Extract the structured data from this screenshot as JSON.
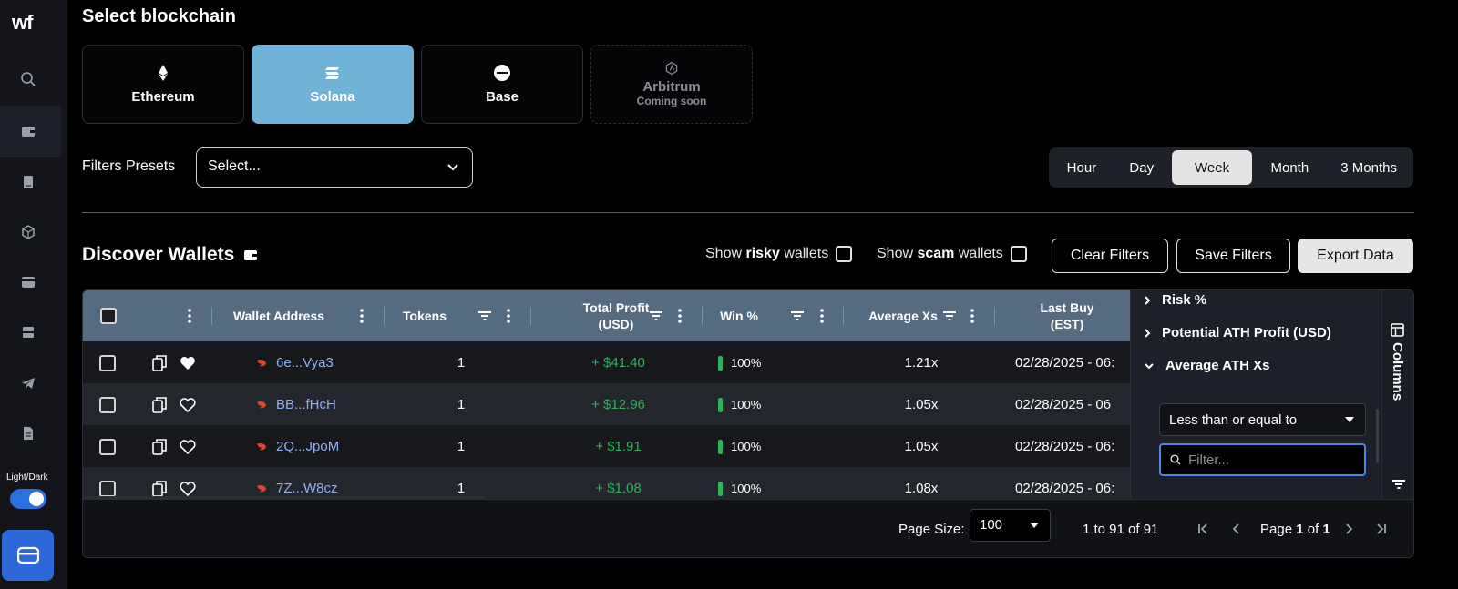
{
  "sidebar": {
    "logo": "wf",
    "toggle_label": "Light/Dark"
  },
  "blockchain": {
    "title": "Select blockchain",
    "options": [
      {
        "label": "Ethereum",
        "icon": "ethereum-icon"
      },
      {
        "label": "Solana",
        "icon": "solana-icon",
        "active": true
      },
      {
        "label": "Base",
        "icon": "base-icon"
      },
      {
        "label": "Arbitrum",
        "icon": "arbitrum-icon",
        "sub": "Coming soon",
        "disabled": true
      }
    ]
  },
  "filters": {
    "presets_label": "Filters Presets",
    "preset_value": "Select...",
    "ranges": [
      "Hour",
      "Day",
      "Week",
      "Month",
      "3 Months"
    ],
    "active_range": "Week"
  },
  "discover": {
    "title": "Discover Wallets",
    "show_risky_prefix": "Show",
    "show_risky_bold": "risky",
    "show_risky_suffix": "wallets",
    "show_scam_prefix": "Show",
    "show_scam_bold": "scam",
    "show_scam_suffix": "wallets",
    "clear_filters": "Clear Filters",
    "save_filters": "Save Filters",
    "export_data": "Export Data"
  },
  "table": {
    "headers": {
      "wallet": "Wallet Address",
      "tokens": "Tokens",
      "profit_l1": "Total Profit",
      "profit_l2": "(USD)",
      "win": "Win %",
      "avg": "Average Xs",
      "last_l1": "Last Buy",
      "last_l2": "(EST)"
    },
    "rows": [
      {
        "address": "6e...Vya3",
        "tokens": "1",
        "profit": "+ $41.40",
        "win": "100%",
        "avg": "1.21x",
        "last": "02/28/2025 - 06:",
        "fav": true
      },
      {
        "address": "BB...fHcH",
        "tokens": "1",
        "profit": "+ $12.96",
        "win": "100%",
        "avg": "1.05x",
        "last": "02/28/2025 - 06",
        "fav": false
      },
      {
        "address": "2Q...JpoM",
        "tokens": "1",
        "profit": "+ $1.91",
        "win": "100%",
        "avg": "1.05x",
        "last": "02/28/2025 - 06:",
        "fav": false
      },
      {
        "address": "7Z...W8cz",
        "tokens": "1",
        "profit": "+ $1.08",
        "win": "100%",
        "avg": "1.08x",
        "last": "02/28/2025 - 06:",
        "fav": false
      }
    ],
    "footer": {
      "page_size_label": "Page Size:",
      "page_size": "100",
      "range": "1 to 91 of 91",
      "page_prefix": "Page",
      "page_current": "1",
      "page_of": "of",
      "page_total": "1"
    }
  },
  "column_panel": {
    "items": [
      "Risk %",
      "Potential ATH Profit (USD)",
      "Average ATH Xs"
    ],
    "operator": "Less than or equal to",
    "filter_placeholder": "Filter...",
    "tab_label": "Columns"
  },
  "colors": {
    "accent": "#6fb3d9",
    "profit": "#2fb15a",
    "address": "#8fb1f2",
    "header": "#546b80"
  }
}
